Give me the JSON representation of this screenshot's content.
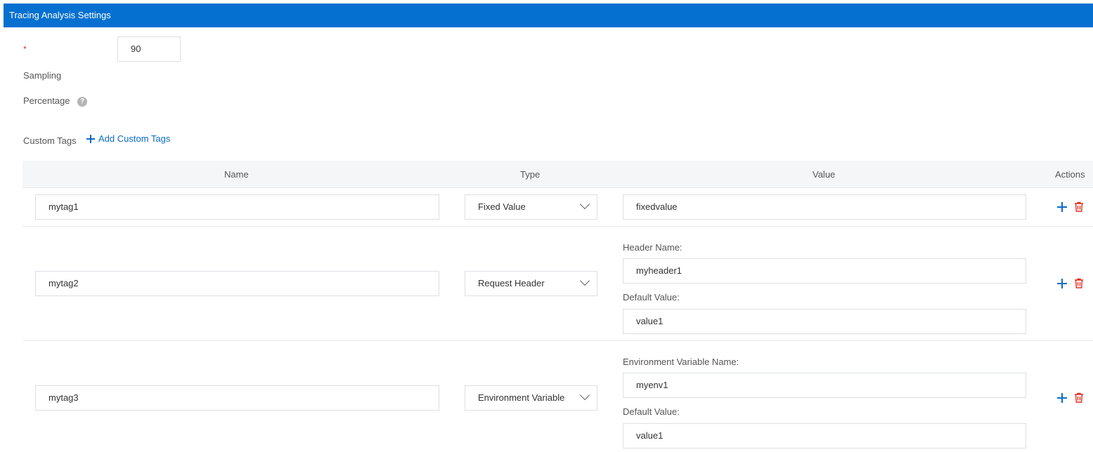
{
  "header": {
    "title": "Tracing Analysis Settings"
  },
  "sampling": {
    "required_mark": "*",
    "value": "90",
    "label_line1": "Sampling",
    "label_line2": "Percentage",
    "help_icon": "question-circle-icon"
  },
  "custom_tags": {
    "label": "Custom Tags",
    "add_label": "Add Custom Tags",
    "columns": {
      "name": "Name",
      "type": "Type",
      "value": "Value",
      "actions": "Actions"
    },
    "rows": [
      {
        "name": "mytag1",
        "type": "Fixed Value",
        "value": "fixedvalue"
      },
      {
        "name": "mytag2",
        "type": "Request Header",
        "value_label": "Header Name:",
        "value": "myheader1",
        "default_label": "Default Value:",
        "default_value": "value1"
      },
      {
        "name": "mytag3",
        "type": "Environment Variable",
        "value_label": "Environment Variable Name:",
        "value": "myenv1",
        "default_label": "Default Value:",
        "default_value": "value1"
      }
    ]
  },
  "colors": {
    "header_bg": "#0570d0",
    "link": "#0b6bc9",
    "delete": "#e0301e",
    "required": "#e0301e"
  },
  "icons": {
    "add_row": "plus-icon",
    "delete_row": "trash-icon",
    "dropdown": "chevron-down-icon"
  }
}
